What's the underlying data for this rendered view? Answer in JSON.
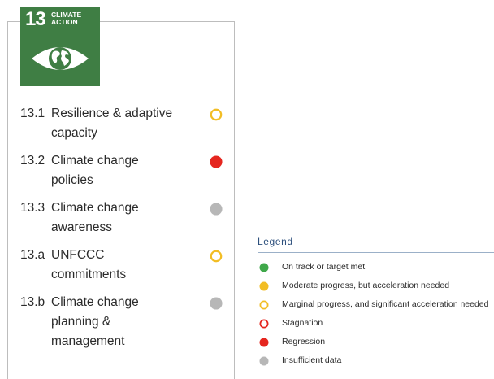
{
  "goal": {
    "number": "13",
    "title_line1": "CLIMATE",
    "title_line2": "ACTION",
    "color": "#3f7e44",
    "icon": "eye-globe-icon"
  },
  "targets": [
    {
      "code": "13.1",
      "label": "Resilience & adaptive capacity",
      "status": "marginal",
      "status_color": "#f2bd24"
    },
    {
      "code": "13.2",
      "label": "Climate change policies",
      "status": "regression",
      "status_color": "#e5261f"
    },
    {
      "code": "13.3",
      "label": "Climate change awareness",
      "status": "insufficient",
      "status_color": "#b7b7b7"
    },
    {
      "code": "13.a",
      "label": "UNFCCC commitments",
      "status": "marginal",
      "status_color": "#f2bd24"
    },
    {
      "code": "13.b",
      "label": "Climate change planning & management",
      "status": "insufficient",
      "status_color": "#b7b7b7"
    }
  ],
  "legend": {
    "title": "Legend",
    "items": [
      {
        "label": "On track or target met",
        "kind": "filled",
        "color": "#3fa84a"
      },
      {
        "label": "Moderate progress, but acceleration needed",
        "kind": "filled",
        "color": "#f2bd24"
      },
      {
        "label": "Marginal progress, and significant acceleration needed",
        "kind": "ring",
        "color": "#f2bd24"
      },
      {
        "label": "Stagnation",
        "kind": "ring",
        "color": "#e5261f"
      },
      {
        "label": "Regression",
        "kind": "filled",
        "color": "#e5261f"
      },
      {
        "label": "Insufficient data",
        "kind": "filled",
        "color": "#b7b7b7"
      }
    ]
  }
}
